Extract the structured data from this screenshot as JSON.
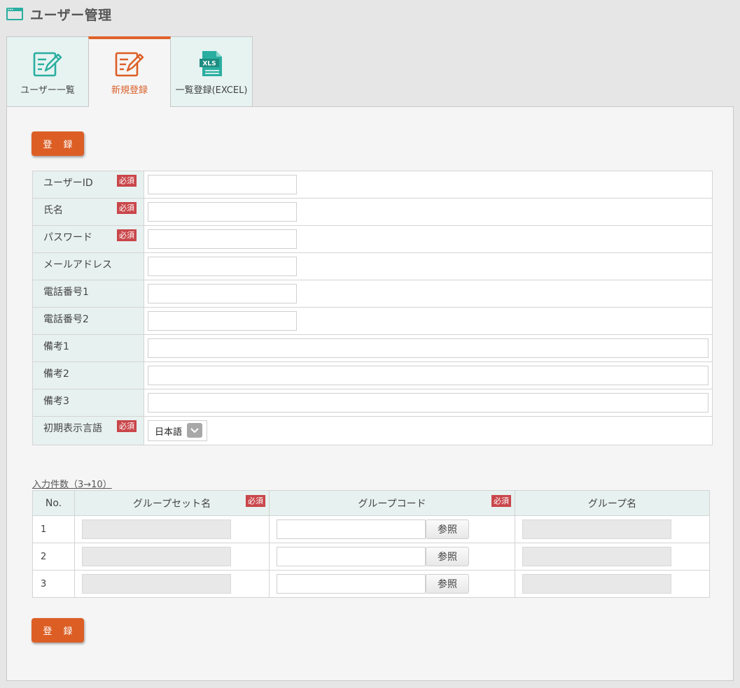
{
  "header": {
    "title": "ユーザー管理"
  },
  "tabs": [
    {
      "label": "ユーザー一覧",
      "icon": "edit-list-icon"
    },
    {
      "label": "新規登録",
      "icon": "edit-new-icon"
    },
    {
      "label": "一覧登録(EXCEL)",
      "icon": "xls-file-icon",
      "icon_text": "XLS"
    }
  ],
  "actions": {
    "register_label": "登 録"
  },
  "required_label": "必須",
  "form": {
    "user_id": {
      "label": "ユーザーID",
      "value": ""
    },
    "name": {
      "label": "氏名",
      "value": ""
    },
    "password": {
      "label": "パスワード",
      "value": ""
    },
    "email": {
      "label": "メールアドレス",
      "value": ""
    },
    "phone1": {
      "label": "電話番号1",
      "value": ""
    },
    "phone2": {
      "label": "電話番号2",
      "value": ""
    },
    "note1": {
      "label": "備考1",
      "value": ""
    },
    "note2": {
      "label": "備考2",
      "value": ""
    },
    "note3": {
      "label": "備考3",
      "value": ""
    },
    "language": {
      "label": "初期表示言語",
      "value": "日本語"
    }
  },
  "groups": {
    "count_link": "入力件数（3→10）",
    "columns": [
      "No.",
      "グループセット名",
      "グループコード",
      "グループ名"
    ],
    "reference_label": "参照",
    "rows": [
      {
        "no": "1"
      },
      {
        "no": "2"
      },
      {
        "no": "3"
      }
    ]
  },
  "colors": {
    "accent": "#dc5e25",
    "tab_active": "#e0622a",
    "teal": "#2aaea0",
    "required": "#c9464a",
    "label_bg": "#e7f1ef"
  }
}
